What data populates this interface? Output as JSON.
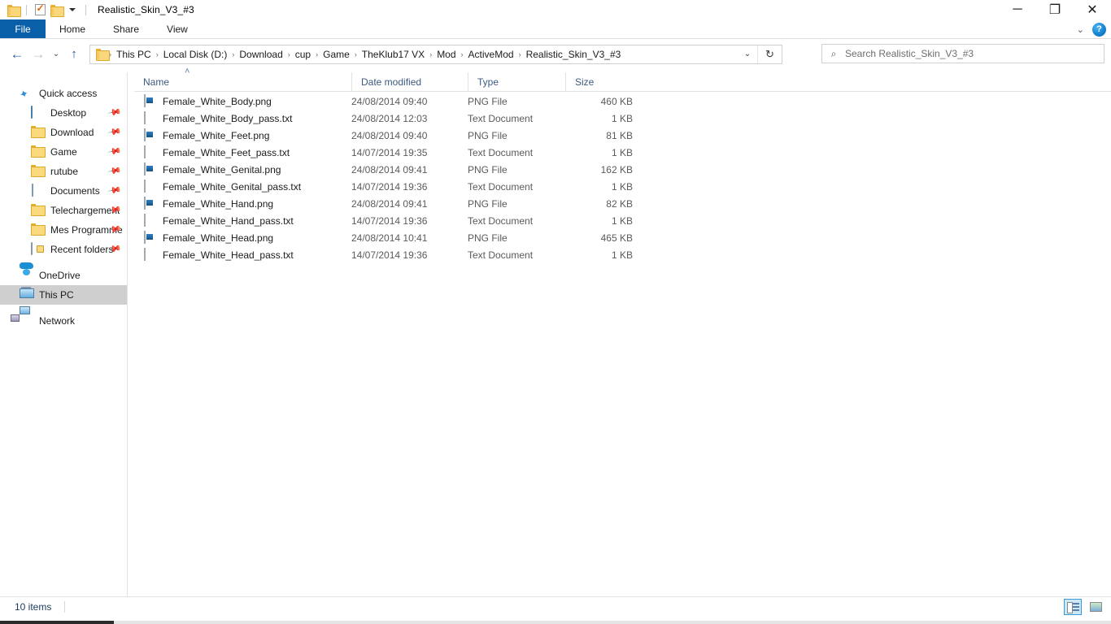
{
  "window": {
    "title": "Realistic_Skin_V3_#3",
    "quick_access_toolbar": [
      {
        "icon": "folder-icon",
        "name": "folder-properties"
      },
      {
        "icon": "properties-checkmark-icon",
        "name": "properties"
      },
      {
        "icon": "new-folder-icon",
        "name": "new-folder"
      }
    ],
    "controls": {
      "minimize": "─",
      "maximize": "❐",
      "close": "✕"
    }
  },
  "ribbon": {
    "file_tab": "File",
    "tabs": [
      "Home",
      "Share",
      "View"
    ],
    "expand_icon": "⌄",
    "help_label": "?"
  },
  "addressbar": {
    "back_icon": "←",
    "forward_icon": "→",
    "recent_icon": "⌄",
    "up_icon": "↑",
    "crumbs": [
      "This PC",
      "Local Disk (D:)",
      "Download",
      "cup",
      "Game",
      "TheKlub17 VX",
      "Mod",
      "ActiveMod",
      "Realistic_Skin_V3_#3"
    ],
    "separator": "›",
    "dropdown_icon": "⌄",
    "refresh_icon": "↻"
  },
  "search": {
    "placeholder": "Search Realistic_Skin_V3_#3",
    "icon": "⌕"
  },
  "columns": {
    "name": "Name",
    "date_modified": "Date modified",
    "type": "Type",
    "size": "Size",
    "sort_indicator": "˄"
  },
  "sidebar": {
    "groups": [
      {
        "label": "Quick access",
        "icon": "star-pin-icon",
        "items": [
          {
            "label": "Desktop",
            "icon": "desktop-icon",
            "pinned": true
          },
          {
            "label": "Download",
            "icon": "folder-icon",
            "pinned": true
          },
          {
            "label": "Game",
            "icon": "folder-icon",
            "pinned": true
          },
          {
            "label": "rutube",
            "icon": "folder-icon",
            "pinned": true
          },
          {
            "label": "Documents",
            "icon": "documents-icon",
            "pinned": true
          },
          {
            "label": "Telechargement",
            "icon": "folder-icon",
            "pinned": true
          },
          {
            "label": "Mes Programme",
            "icon": "folder-icon",
            "pinned": true
          },
          {
            "label": "Recent folders",
            "icon": "recent-folders-icon",
            "pinned": true
          }
        ]
      }
    ],
    "roots": [
      {
        "label": "OneDrive",
        "icon": "onedrive-icon",
        "selected": false
      },
      {
        "label": "This PC",
        "icon": "this-pc-icon",
        "selected": true
      },
      {
        "label": "Network",
        "icon": "network-icon",
        "selected": false
      }
    ],
    "pin_icon": "📌"
  },
  "files": [
    {
      "name": "Female_White_Body.png",
      "date": "24/08/2014 09:40",
      "type": "PNG File",
      "size": "460 KB",
      "icon": "png-file-icon"
    },
    {
      "name": "Female_White_Body_pass.txt",
      "date": "24/08/2014 12:03",
      "type": "Text Document",
      "size": "1 KB",
      "icon": "text-file-icon"
    },
    {
      "name": "Female_White_Feet.png",
      "date": "24/08/2014 09:40",
      "type": "PNG File",
      "size": "81 KB",
      "icon": "png-file-icon"
    },
    {
      "name": "Female_White_Feet_pass.txt",
      "date": "14/07/2014 19:35",
      "type": "Text Document",
      "size": "1 KB",
      "icon": "text-file-icon"
    },
    {
      "name": "Female_White_Genital.png",
      "date": "24/08/2014 09:41",
      "type": "PNG File",
      "size": "162 KB",
      "icon": "png-file-icon"
    },
    {
      "name": "Female_White_Genital_pass.txt",
      "date": "14/07/2014 19:36",
      "type": "Text Document",
      "size": "1 KB",
      "icon": "text-file-icon"
    },
    {
      "name": "Female_White_Hand.png",
      "date": "24/08/2014 09:41",
      "type": "PNG File",
      "size": "82 KB",
      "icon": "png-file-icon"
    },
    {
      "name": "Female_White_Hand_pass.txt",
      "date": "14/07/2014 19:36",
      "type": "Text Document",
      "size": "1 KB",
      "icon": "text-file-icon"
    },
    {
      "name": "Female_White_Head.png",
      "date": "24/08/2014 10:41",
      "type": "PNG File",
      "size": "465 KB",
      "icon": "png-file-icon"
    },
    {
      "name": "Female_White_Head_pass.txt",
      "date": "14/07/2014 19:36",
      "type": "Text Document",
      "size": "1 KB",
      "icon": "text-file-icon"
    }
  ],
  "statusbar": {
    "item_count": "10 items",
    "views": [
      {
        "name": "details-view",
        "active": true
      },
      {
        "name": "large-icons-view",
        "active": false
      }
    ]
  },
  "colors": {
    "accent": "#0a60a8",
    "selection": "#cfcfcf",
    "hover": "#e5f3fb",
    "header_text": "#3b5a80"
  }
}
